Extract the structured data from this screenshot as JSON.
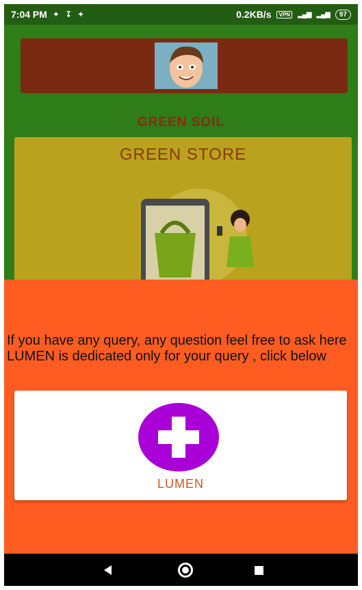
{
  "status_bar": {
    "time": "7:04 PM",
    "speed": "0.2KB/s",
    "vpn": "VPN",
    "battery": "97"
  },
  "background": {
    "app_title": "GREEN SOIL",
    "store_title": "GREEN STORE"
  },
  "sheet": {
    "message": "If you have any query, any question feel free to ask here LUMEN is dedicated only for your query , click below",
    "button_label": "LUMEN"
  },
  "colors": {
    "background_green": "#2e7d18",
    "sheet_orange": "#ff5c22",
    "plus_purple": "#a800d6",
    "lumen_text": "#d0541e"
  },
  "icons": [
    "flash-icon",
    "download-icon",
    "vpn-icon",
    "signal-icon",
    "battery-icon",
    "plus-icon",
    "back-icon",
    "home-icon",
    "recents-icon"
  ]
}
